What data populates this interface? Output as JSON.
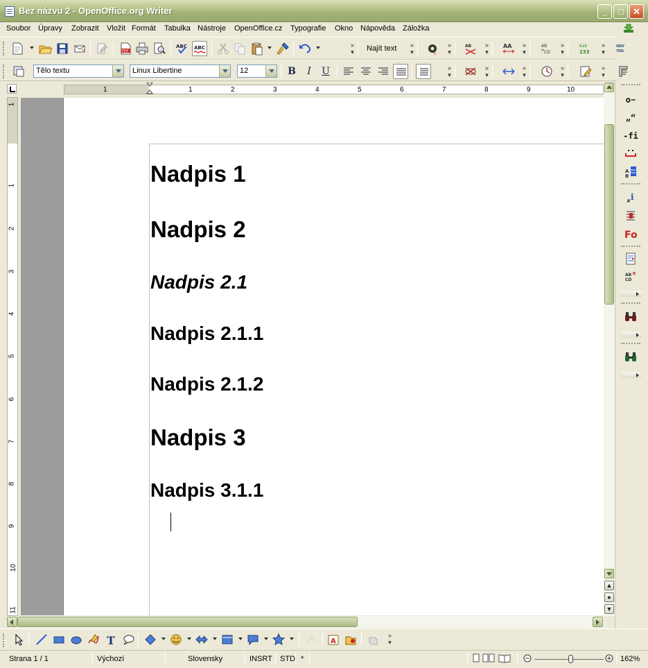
{
  "window": {
    "title": "Bez názvu 2 - OpenOffice.org Writer"
  },
  "menu": {
    "items": [
      {
        "label": "Soubor",
        "accel": "S"
      },
      {
        "label": "Úpravy",
        "accel": "Ú"
      },
      {
        "label": "Zobrazit",
        "accel": "Z"
      },
      {
        "label": "Vložit",
        "accel": "l"
      },
      {
        "label": "Formát",
        "accel": "o"
      },
      {
        "label": "Tabulka",
        "accel": "T"
      },
      {
        "label": "Nástroje",
        "accel": "N"
      },
      {
        "label": "OpenOffice.cz",
        "accel": ""
      },
      {
        "label": "Typografie",
        "accel": ""
      },
      {
        "label": "Okno",
        "accel": "O"
      },
      {
        "label": "Nápověda",
        "accel": "v"
      },
      {
        "label": "Záložka",
        "accel": ""
      }
    ]
  },
  "toolbar": {
    "find_text": "Najít text",
    "paragraph_style": "Tělo textu",
    "font_name": "Linux Libertine",
    "font_size": "12",
    "bold": "B",
    "italic": "I",
    "underline": "U"
  },
  "ruler": {
    "h_ticks": [
      "1",
      "1",
      "2",
      "3",
      "4",
      "5",
      "6",
      "7",
      "8",
      "9",
      "10"
    ],
    "v_ticks": [
      "1",
      "1",
      "2",
      "3",
      "4",
      "5",
      "6",
      "7",
      "8",
      "9",
      "10",
      "11"
    ]
  },
  "document": {
    "headings": [
      {
        "text": "Nadpis 1",
        "level": 1
      },
      {
        "text": "Nadpis 2",
        "level": 2
      },
      {
        "text": "Nadpis 2.1",
        "level": 3
      },
      {
        "text": "Nadpis 2.1.1",
        "level": 4
      },
      {
        "text": "Nadpis 2.1.2",
        "level": 4
      },
      {
        "text": "Nadpis 3",
        "level": 2
      },
      {
        "text": "Nadpis 3.1.1",
        "level": 4
      }
    ]
  },
  "rightbar": {
    "items": [
      "o~",
      "„“",
      "-fi",
      "",
      "",
      "",
      "",
      "",
      "",
      ""
    ]
  },
  "status": {
    "page": "Strana 1 / 1",
    "page_style": "Výchozí",
    "language": "Slovensky",
    "insert_mode": "INSRT",
    "selection_mode": "STD",
    "modified": "*",
    "zoom": "162%"
  },
  "colors": {
    "titlebar": "#a3b178",
    "accent_olive": "#8ea064",
    "doc_gray": "#9c9c9c"
  }
}
